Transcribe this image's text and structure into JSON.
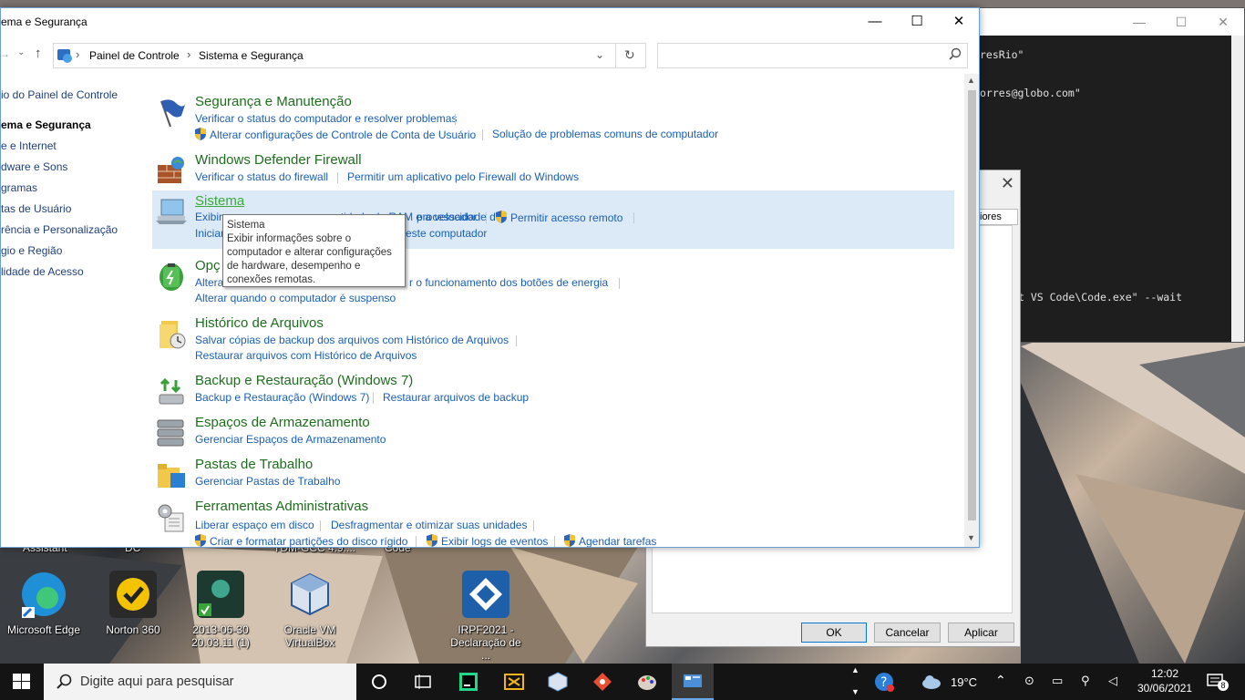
{
  "window": {
    "title": "ema e Segurança",
    "minimize": "—",
    "maximize": "☐",
    "close": "✕"
  },
  "address": {
    "crumbs": [
      "Painel de Controle",
      "Sistema e Segurança"
    ],
    "search_placeholder": ""
  },
  "left_nav": {
    "items": [
      {
        "label": "io do Painel de Controle",
        "current": false
      },
      {
        "label": "ema e Segurança",
        "current": true
      },
      {
        "label": "e e Internet",
        "current": false
      },
      {
        "label": "dware e Sons",
        "current": false
      },
      {
        "label": "gramas",
        "current": false
      },
      {
        "label": "tas de Usuário",
        "current": false
      },
      {
        "label": "rência e Personalização",
        "current": false
      },
      {
        "label": "gio e Região",
        "current": false
      },
      {
        "label": "lidade de Acesso",
        "current": false
      }
    ]
  },
  "categories": [
    {
      "title": "Segurança e Manutenção",
      "links": [
        "Verificar o status do computador e resolver problemas",
        "Alterar configurações de Controle de Conta de Usuário",
        "Solução de problemas comuns de computador"
      ]
    },
    {
      "title": "Windows Defender Firewall",
      "links": [
        "Verificar o status do firewall",
        "Permitir um aplicativo pelo Firewall do Windows"
      ]
    },
    {
      "title": "Sistema",
      "links": [
        "Exibir",
        "quantidade de RAM e a velocidade do",
        "processador",
        "Permitir acesso remoto",
        "Inician",
        "este computador"
      ]
    },
    {
      "title": "Opç",
      "links": [
        "Altera",
        "r o funcionamento dos botões de energia",
        "Alterar quando o computador é suspenso"
      ]
    },
    {
      "title": "Histórico de Arquivos",
      "links": [
        "Salvar cópias de backup dos arquivos com Histórico de Arquivos",
        "Restaurar arquivos com Histórico de Arquivos"
      ]
    },
    {
      "title": "Backup e Restauração (Windows 7)",
      "links": [
        "Backup e Restauração (Windows 7)",
        "Restaurar arquivos de backup"
      ]
    },
    {
      "title": "Espaços de Armazenamento",
      "links": [
        "Gerenciar Espaços de Armazenamento"
      ]
    },
    {
      "title": "Pastas de Trabalho",
      "links": [
        "Gerenciar Pastas de Trabalho"
      ]
    },
    {
      "title": "Ferramentas Administrativas",
      "links": [
        "Liberar espaço em disco",
        "Desfragmentar e otimizar suas unidades",
        "Criar e formatar partições do disco rígido",
        "Exibir logs de eventos",
        "Agendar tarefas"
      ]
    }
  ],
  "tooltip": {
    "title": "Sistema",
    "body": "Exibir informações sobre o computador e alterar configurações de hardware, desempenho e conexões remotas."
  },
  "terminal": {
    "lines": [
      "resRio\"",
      "orres@globo.com\"",
      "t VS Code\\Code.exe\" --wait"
    ]
  },
  "dialog": {
    "tab": "iores",
    "ok": "OK",
    "cancel": "Cancelar",
    "apply": "Aplicar"
  },
  "desktop": {
    "top_labels": [
      "Assistant",
      "DC",
      "TDM-GCC 4.9....",
      "Code"
    ],
    "icons": [
      {
        "label": "Microsoft Edge"
      },
      {
        "label": "Norton 360"
      },
      {
        "label": "2013-06-30 20.03.11 (1)"
      },
      {
        "label": "Oracle VM VirtualBox"
      },
      {
        "label": "IRPF2021 - Declaração de ..."
      }
    ]
  },
  "taskbar": {
    "search_placeholder": "Digite aqui para pesquisar",
    "temperature": "19°C",
    "time": "12:02",
    "date": "30/06/2021",
    "notifications": "8"
  },
  "colors": {
    "link": "#1a5fb4",
    "category_title": "#1e6e1e",
    "hover_bg": "#dceaf8",
    "taskbar": "#141414"
  }
}
